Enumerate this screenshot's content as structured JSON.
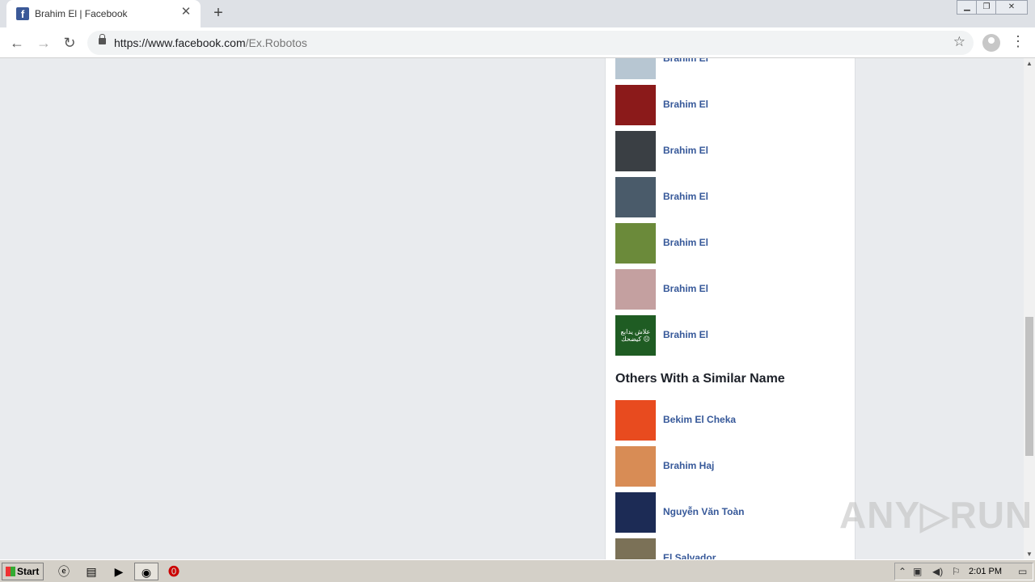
{
  "browser": {
    "tab_title": "Brahim El | Facebook",
    "tab_icon": "f",
    "url_host": "https://www.facebook.com",
    "url_path": "/Ex.Robotos"
  },
  "main": {
    "rows": [
      {
        "name": "Brahim El",
        "color": "#b7c6d2"
      },
      {
        "name": "Brahim El",
        "color": "#8b1a1a"
      },
      {
        "name": "Brahim El",
        "color": "#3a3f44"
      },
      {
        "name": "Brahim El",
        "color": "#4a5b6a"
      },
      {
        "name": "Brahim El",
        "color": "#6b8a3a"
      },
      {
        "name": "Brahim El",
        "color": "#c4a0a0"
      },
      {
        "name": "Brahim El",
        "color": "#1f5c23",
        "caption": "علاش يدابع كيضحك ☹"
      }
    ],
    "section_title": "Others With a Similar Name",
    "similar": [
      {
        "name": "Bekim El Cheka",
        "color": "#e84b1f"
      },
      {
        "name": "Brahim Haj",
        "color": "#d88c55"
      },
      {
        "name": "Nguyễn Văn Toàn",
        "color": "#1c2b55"
      },
      {
        "name": "El Salvador",
        "color": "#7b7157"
      }
    ]
  },
  "watermark": "ANY▷RUN",
  "taskbar": {
    "start_label": "Start",
    "clock": "2:01 PM"
  }
}
